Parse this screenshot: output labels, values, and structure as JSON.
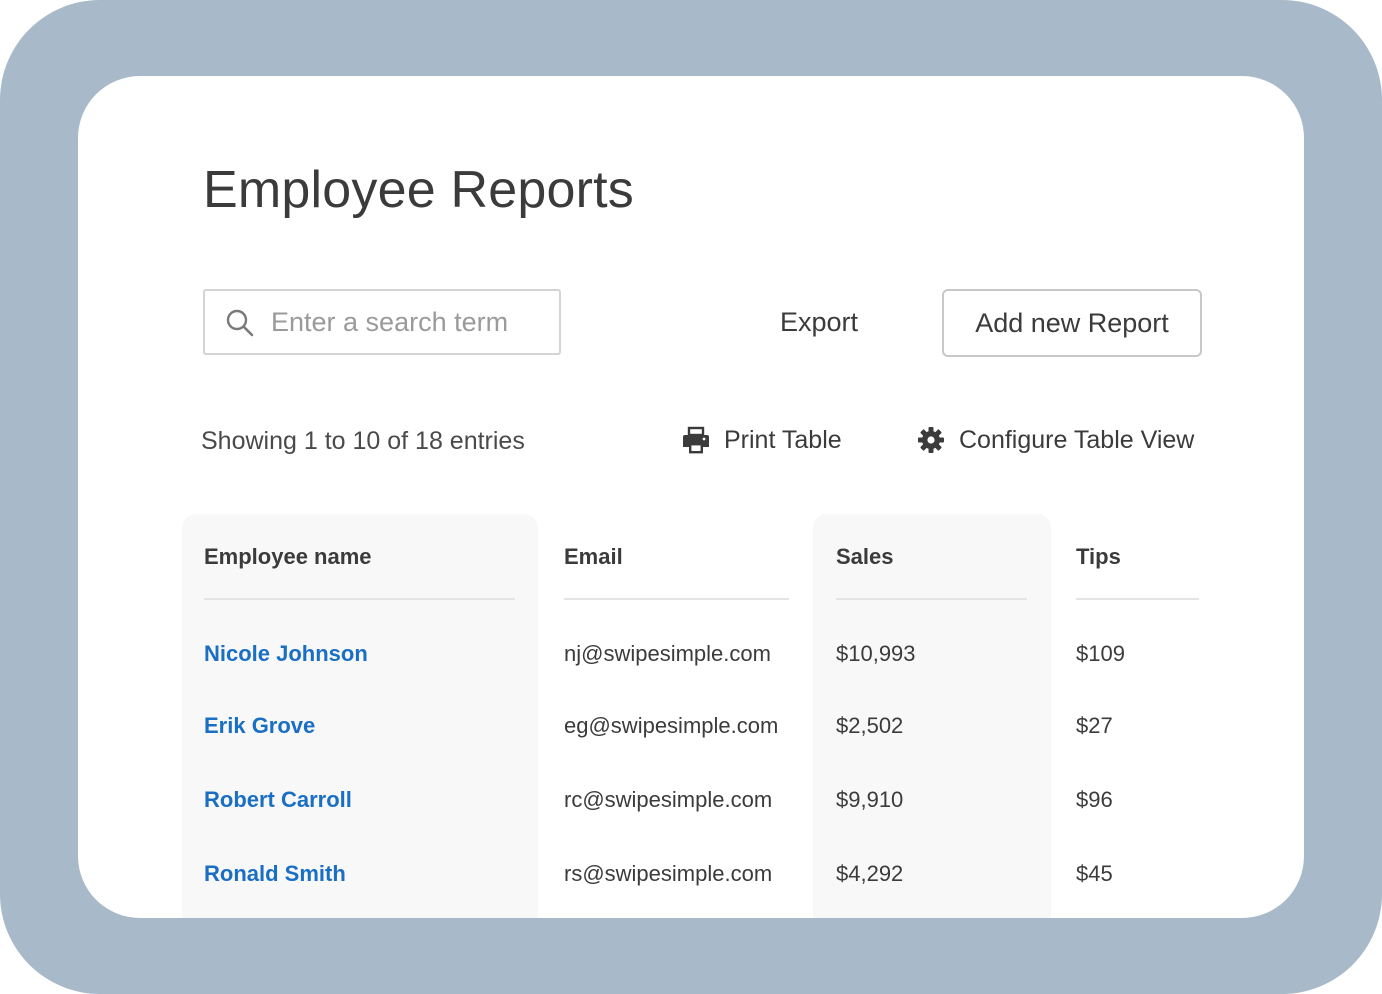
{
  "page": {
    "title": "Employee Reports"
  },
  "toolbar": {
    "search_placeholder": "Enter a search term",
    "search_value": "",
    "export_label": "Export",
    "add_label": "Add new Report"
  },
  "table_meta": {
    "entries_text": "Showing 1 to 10 of 18 entries",
    "print_label": "Print Table",
    "configure_label": "Configure Table View"
  },
  "table": {
    "columns": [
      "Employee name",
      "Email",
      "Sales",
      "Tips"
    ],
    "rows": [
      {
        "name": "Nicole Johnson",
        "email": "nj@swipesimple.com",
        "sales": "$10,993",
        "tips": "$109"
      },
      {
        "name": "Erik Grove",
        "email": "eg@swipesimple.com",
        "sales": "$2,502",
        "tips": "$27"
      },
      {
        "name": "Robert Carroll",
        "email": "rc@swipesimple.com",
        "sales": "$9,910",
        "tips": "$96"
      },
      {
        "name": "Ronald Smith",
        "email": "rs@swipesimple.com",
        "sales": "$4,292",
        "tips": "$45"
      }
    ]
  },
  "icons": {
    "search": "search-icon",
    "print": "printer-icon",
    "configure": "gear-icon"
  },
  "colors": {
    "frame": "#a8b9ca",
    "link": "#1a6fc4",
    "text": "#3b3b3b",
    "column_highlight": "#f8f8f8"
  }
}
